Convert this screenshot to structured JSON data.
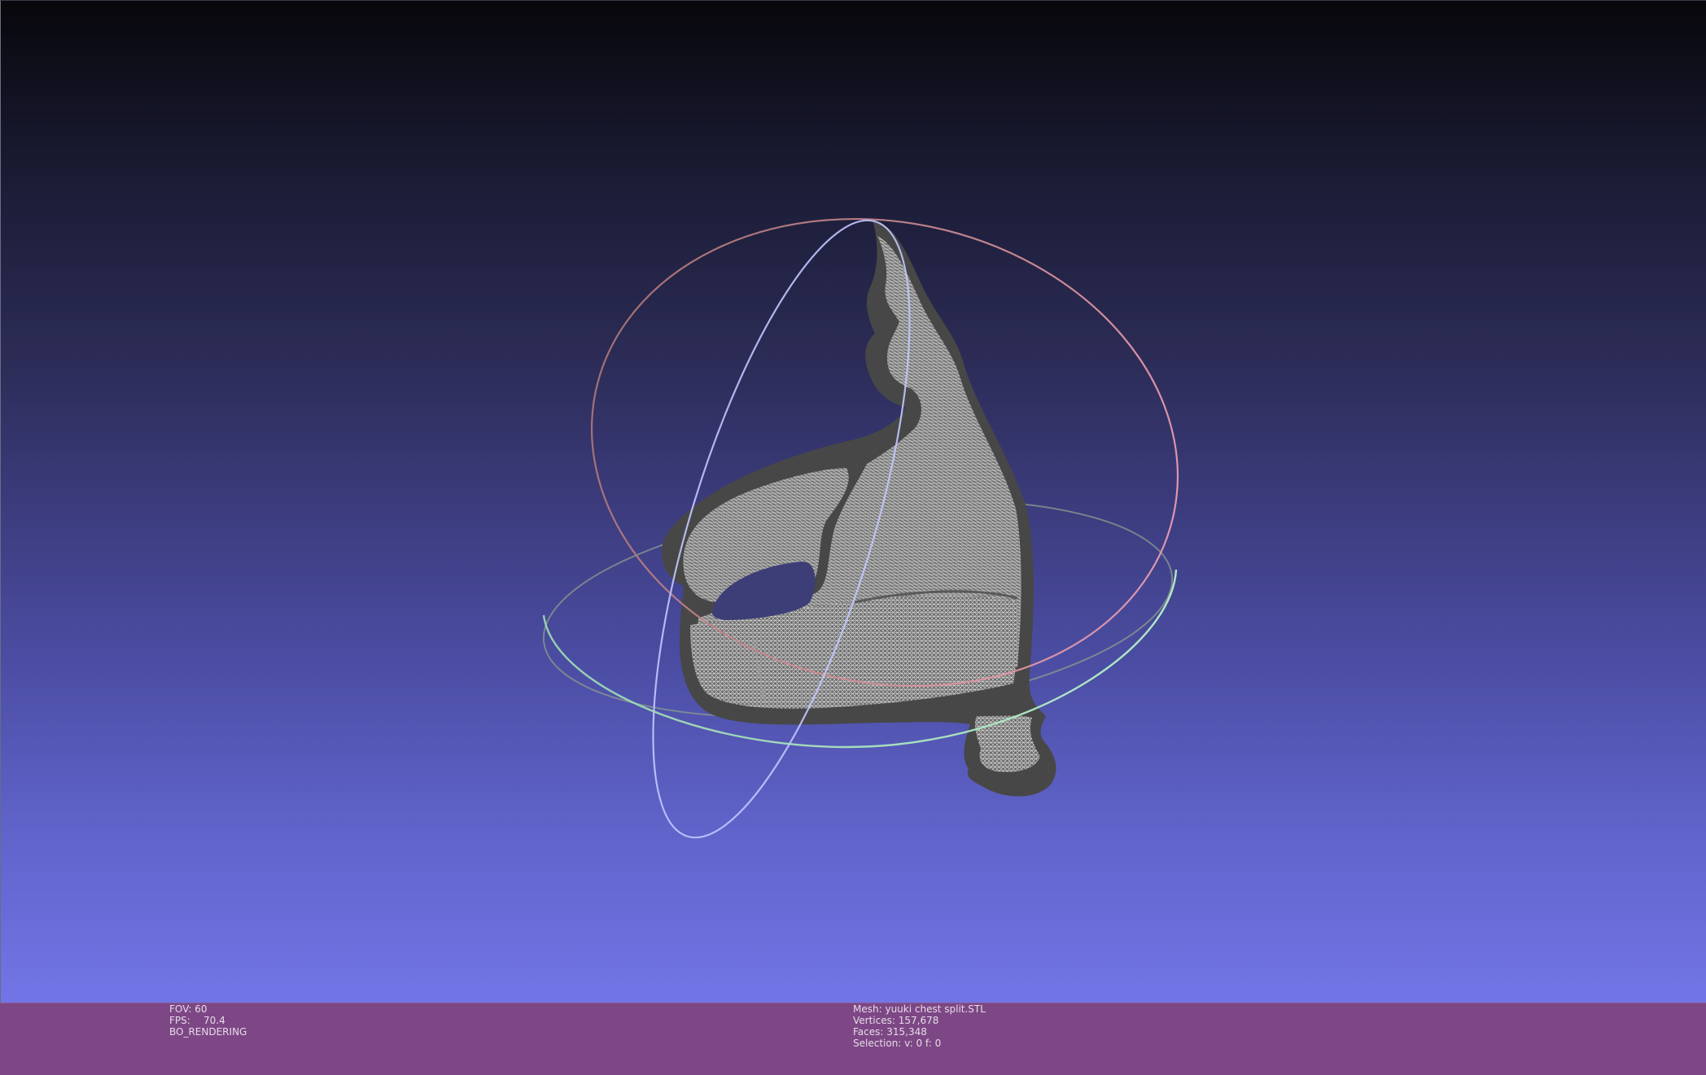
{
  "viewer": {
    "mesh_color": "#4a4a4a",
    "wire_color": "#d9d9d9",
    "trackball": {
      "horizontal_ring": "green-ring",
      "vertical_ring": "blue-ring",
      "tilted_ring": "red-ring"
    }
  },
  "status_left": {
    "fov_label": "FOV:",
    "fov_value": "60",
    "fps_label": "FPS:",
    "fps_value": "70.4",
    "render_mode": "BO_RENDERING"
  },
  "status_center": {
    "mesh_label": "Mesh:",
    "mesh_name": "yuuki chest split.STL",
    "vertices_label": "Vertices:",
    "vertices_value": "157,678",
    "faces_label": "Faces:",
    "faces_value": "315,348",
    "selection_label": "Selection:",
    "selection_value": "v: 0 f: 0"
  },
  "colors": {
    "statusbar_bg": "#7d4785",
    "status_text": "#e6dce8",
    "bg_top": "#07070b",
    "bg_bottom": "#7275e6"
  }
}
